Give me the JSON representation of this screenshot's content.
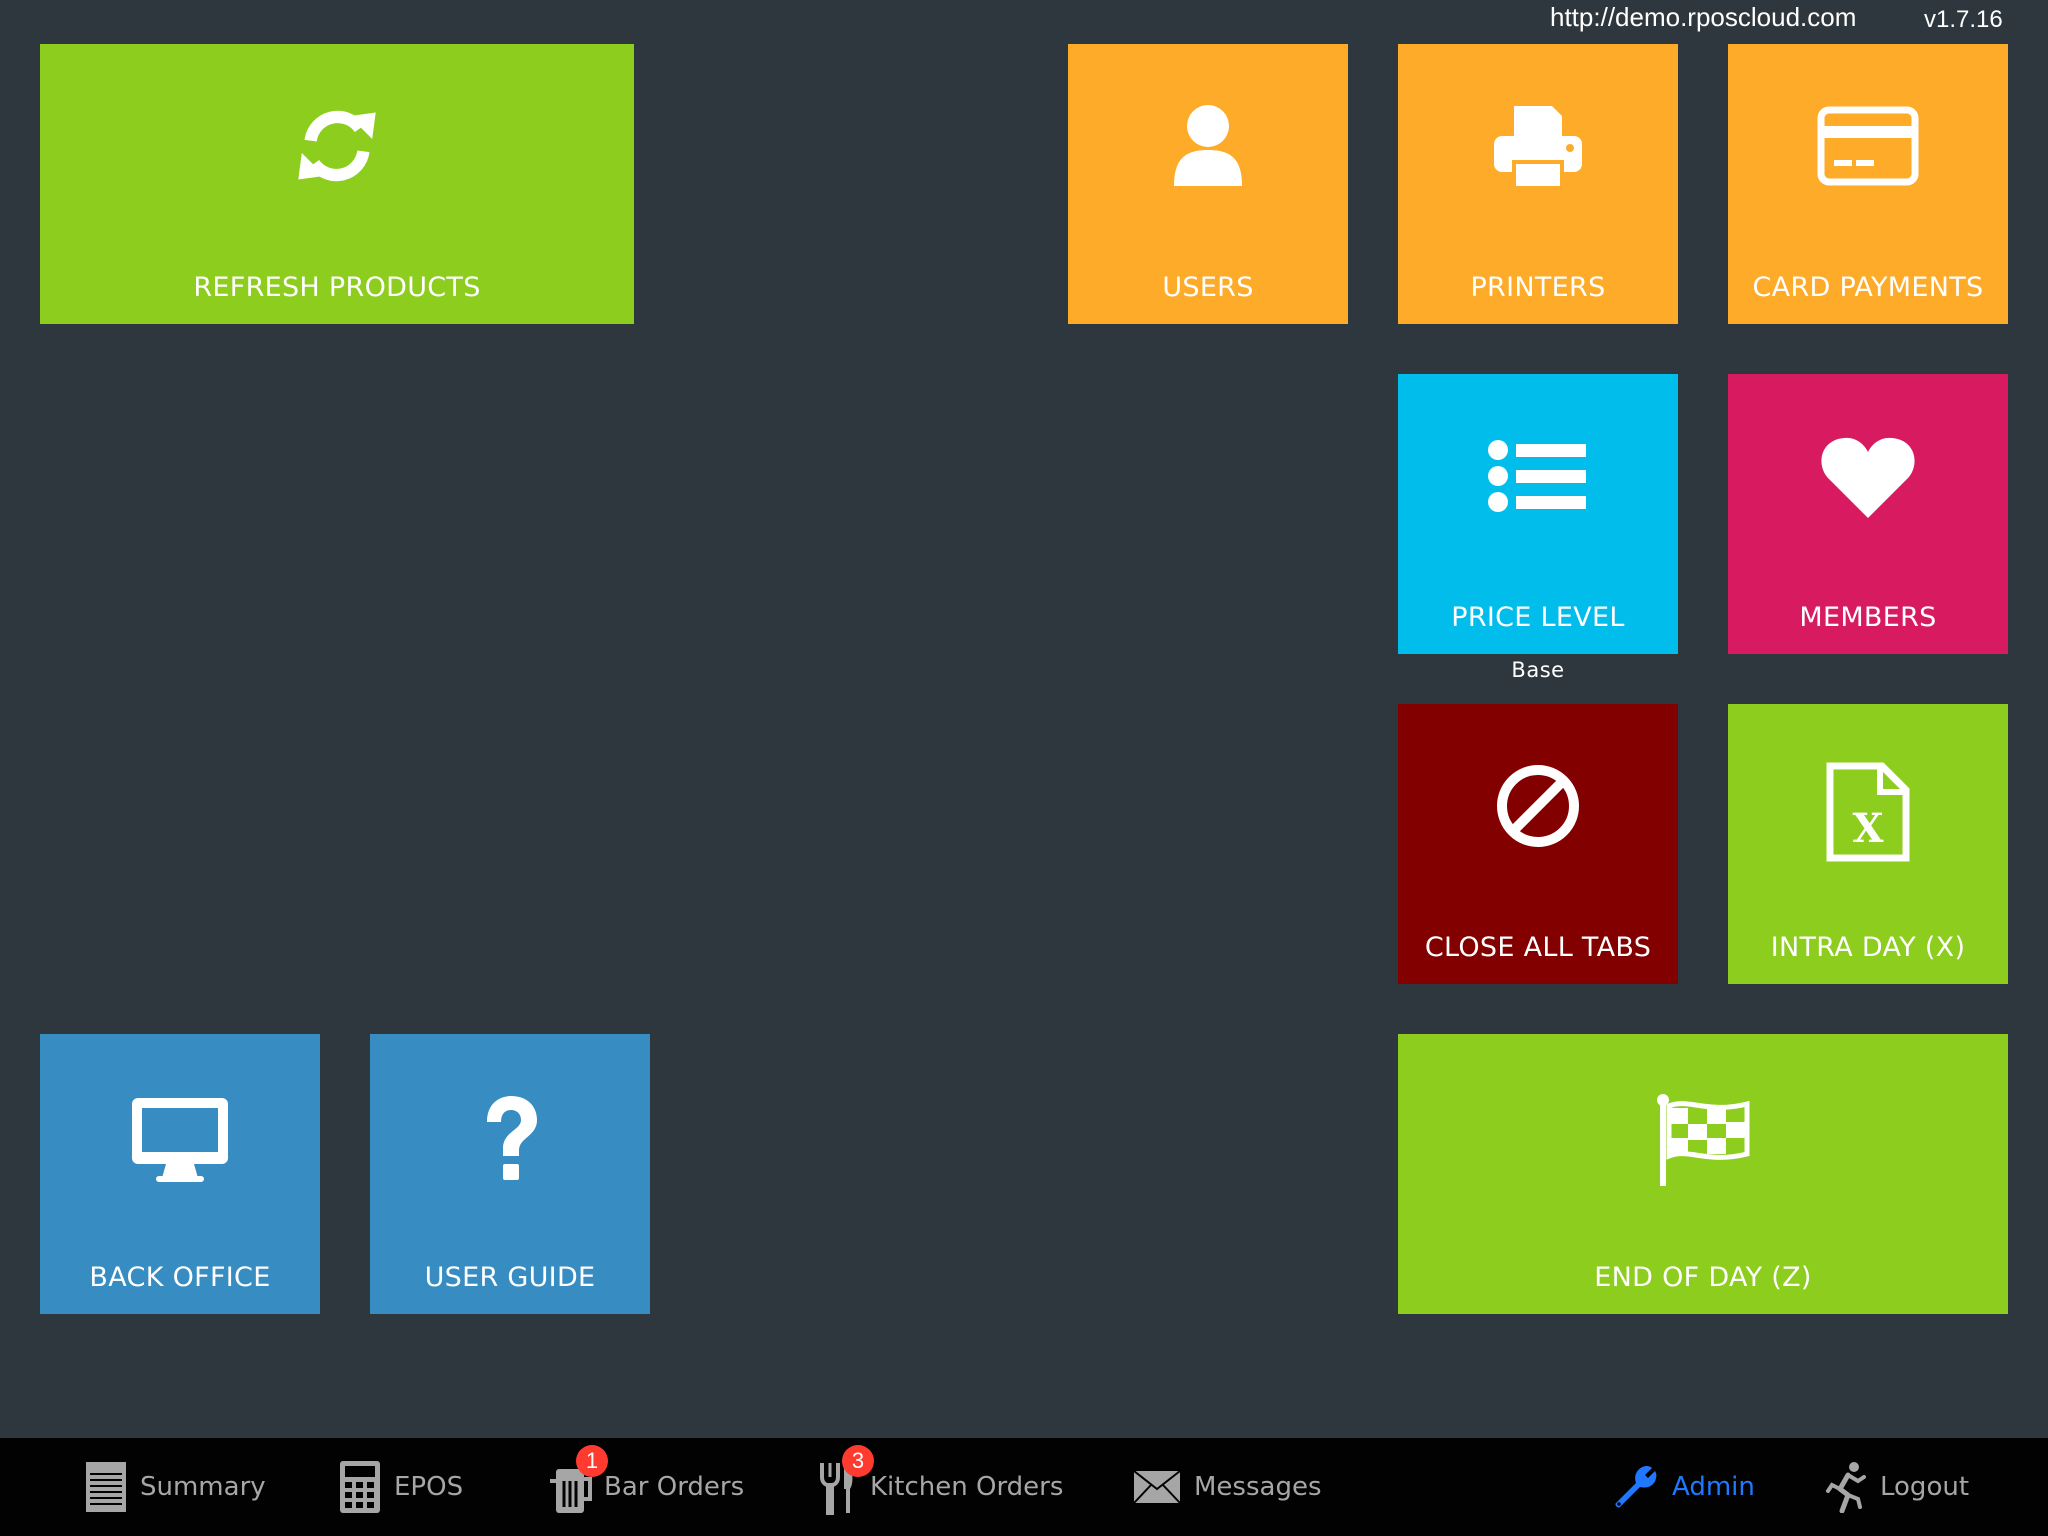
{
  "header": {
    "url": "http://demo.rposcloud.com",
    "version": "v1.7.16"
  },
  "tiles": {
    "refresh_products": {
      "label": "REFRESH PRODUCTS",
      "icon": "refresh-icon",
      "color": "#8ccd1e"
    },
    "users": {
      "label": "USERS",
      "icon": "user-icon",
      "color": "#fdab28"
    },
    "printers": {
      "label": "PRINTERS",
      "icon": "printer-icon",
      "color": "#fdab28"
    },
    "card_payments": {
      "label": "CARD PAYMENTS",
      "icon": "credit-card-icon",
      "color": "#fdab28"
    },
    "price_level": {
      "label": "PRICE LEVEL",
      "value": "Base",
      "icon": "list-icon",
      "color": "#00bdec"
    },
    "members": {
      "label": "MEMBERS",
      "icon": "heart-icon",
      "color": "#d81b60"
    },
    "close_all_tabs": {
      "label": "CLOSE ALL TABS",
      "icon": "ban-icon",
      "color": "#820000"
    },
    "intra_day": {
      "label": "INTRA DAY (X)",
      "icon": "excel-file-icon",
      "color": "#8ccd1e"
    },
    "back_office": {
      "label": "BACK OFFICE",
      "icon": "desktop-icon",
      "color": "#378dc2"
    },
    "user_guide": {
      "label": "USER GUIDE",
      "icon": "question-icon",
      "color": "#378dc2"
    },
    "end_of_day": {
      "label": "END OF DAY (Z)",
      "icon": "checkered-flag-icon",
      "color": "#8ccd1e"
    }
  },
  "tabbar": {
    "items": [
      {
        "label": "Summary",
        "icon": "notepad-icon"
      },
      {
        "label": "EPOS",
        "icon": "calculator-icon"
      },
      {
        "label": "Bar Orders",
        "icon": "beer-icon",
        "badge": "1"
      },
      {
        "label": "Kitchen Orders",
        "icon": "cutlery-icon",
        "badge": "3"
      },
      {
        "label": "Messages",
        "icon": "envelope-icon"
      },
      {
        "label": "Admin",
        "icon": "wrench-icon",
        "active": true
      },
      {
        "label": "Logout",
        "icon": "running-man-icon"
      }
    ],
    "active_color": "#1f78ff",
    "inactive_color": "#a6a6a6",
    "badge_color": "#ff3b30"
  }
}
